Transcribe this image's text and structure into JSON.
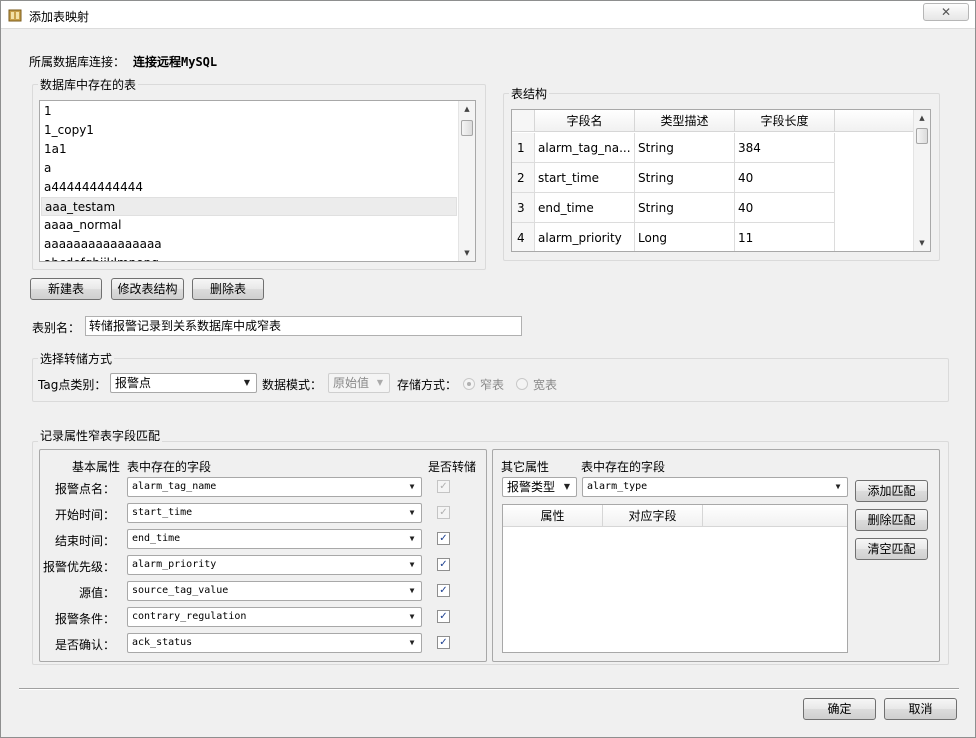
{
  "window": {
    "title": "添加表映射",
    "close_label": "✕"
  },
  "connection": {
    "label": "所属数据库连接：",
    "value": "连接远程MySQL"
  },
  "tables_group": {
    "title": "数据库中存在的表",
    "items": [
      "1",
      "1_copy1",
      "1a1",
      "a",
      "a444444444444",
      "aaa_testam",
      "aaaa_normal",
      "aaaaaaaaaaaaaaaa",
      "abcdefghijklmnopq"
    ],
    "selected_index": 5
  },
  "structure_group": {
    "title": "表结构",
    "headers": [
      "字段名",
      "类型描述",
      "字段长度"
    ],
    "rows": [
      {
        "num": "1",
        "name": "alarm_tag_na...",
        "type": "String",
        "length": "384"
      },
      {
        "num": "2",
        "name": "start_time",
        "type": "String",
        "length": "40"
      },
      {
        "num": "3",
        "name": "end_time",
        "type": "String",
        "length": "40"
      },
      {
        "num": "4",
        "name": "alarm_priority",
        "type": "Long",
        "length": "11"
      }
    ]
  },
  "table_buttons": {
    "new": "新建表",
    "modify": "修改表结构",
    "delete": "删除表"
  },
  "alias": {
    "label": "表别名：",
    "value": "转储报警记录到关系数据库中成窄表"
  },
  "storage_group": {
    "title": "选择转储方式",
    "tag_type_label": "Tag点类别：",
    "tag_type_value": "报警点",
    "data_mode_label": "数据模式：",
    "data_mode_value": "原始值",
    "storage_label": "存储方式：",
    "narrow_label": "窄表",
    "wide_label": "宽表"
  },
  "mapping_group": {
    "title": "记录属性窄表字段匹配",
    "col_basic": "基本属性",
    "col_fields": "表中存在的字段",
    "col_store": "是否转储",
    "rows": [
      {
        "label": "报警点名：",
        "field": "alarm_tag_name",
        "checked": true,
        "disabled": true
      },
      {
        "label": "开始时间：",
        "field": "start_time",
        "checked": true,
        "disabled": true
      },
      {
        "label": "结束时间：",
        "field": "end_time",
        "checked": true,
        "disabled": false
      },
      {
        "label": "报警优先级：",
        "field": "alarm_priority",
        "checked": true,
        "disabled": false
      },
      {
        "label": "源值：",
        "field": "source_tag_value",
        "checked": true,
        "disabled": false
      },
      {
        "label": "报警条件：",
        "field": "contrary_regulation",
        "checked": true,
        "disabled": false
      },
      {
        "label": "是否确认：",
        "field": "ack_status",
        "checked": true,
        "disabled": false
      }
    ],
    "other_label": "其它属性",
    "other_fields_label": "表中存在的字段",
    "other_attr_value": "报警类型",
    "other_field_value": "alarm_type",
    "match_headers": [
      "属性",
      "对应字段"
    ],
    "add_match": "添加匹配",
    "delete_match": "删除匹配",
    "clear_match": "清空匹配"
  },
  "footer": {
    "ok": "确定",
    "cancel": "取消"
  },
  "check_mark": "✓"
}
